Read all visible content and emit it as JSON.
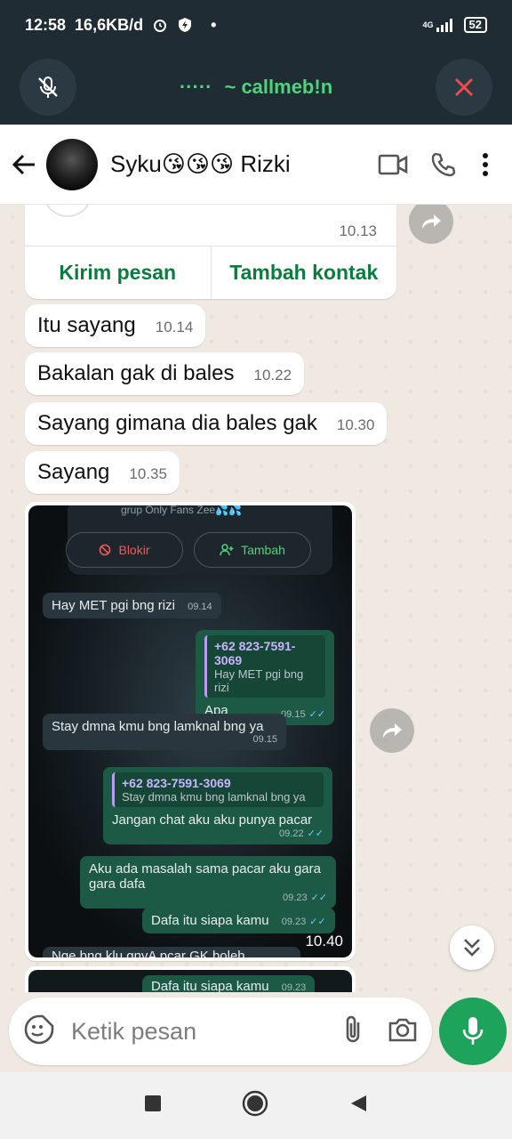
{
  "status": {
    "time": "12:58",
    "speed": "16,6KB/d",
    "dot": "•",
    "network": "4G",
    "battery": "52"
  },
  "call": {
    "dots": "·····",
    "title": "~ callmeb!n"
  },
  "header": {
    "contact_name": "Syku😘😘😘 Rizki"
  },
  "card": {
    "time": "10.13",
    "send_label": "Kirim pesan",
    "add_contact_label": "Tambah kontak"
  },
  "messages": [
    {
      "text": "Itu sayang",
      "time": "10.14"
    },
    {
      "text": "Bakalan gak di bales",
      "time": "10.22"
    },
    {
      "text": "Sayang gimana dia bales gak",
      "time": "10.30"
    },
    {
      "text": "Sayang",
      "time": "10.35"
    }
  ],
  "shot": {
    "group_text": "grup Only Fans Zee💦💦",
    "block_label": "Blokir",
    "add_label": "Tambah",
    "m1": {
      "text": "Hay MET pgi bng rizi",
      "time": "09.14"
    },
    "m2": {
      "quote_name": "+62 823-7591-3069",
      "quote_body": "Hay MET pgi bng rizi",
      "text": "Apa",
      "time": "09.15"
    },
    "m3": {
      "text": "Stay dmna kmu bng lamknal bng ya",
      "time": "09.15"
    },
    "m4": {
      "quote_name": "+62 823-7591-3069",
      "quote_body": "Stay dmna kmu bng lamknal bng ya",
      "text": "Jangan chat aku aku punya pacar",
      "time": "09.22"
    },
    "m5": {
      "text": "Aku ada masalah sama pacar aku gara gara dafa",
      "time": "09.23"
    },
    "m6": {
      "text": "Dafa itu siapa kamu",
      "time": "09.23"
    },
    "m7": {
      "text": "Nge bng klu gnyA pcar GK boleh"
    },
    "stamp": "10.40",
    "second_text": "Dafa itu siapa kamu",
    "second_time": "09.23"
  },
  "input": {
    "placeholder": "Ketik pesan"
  },
  "colors": {
    "accent": "#1ea35a",
    "header_dark": "#1f2c34",
    "call_green": "#4fd47a"
  }
}
